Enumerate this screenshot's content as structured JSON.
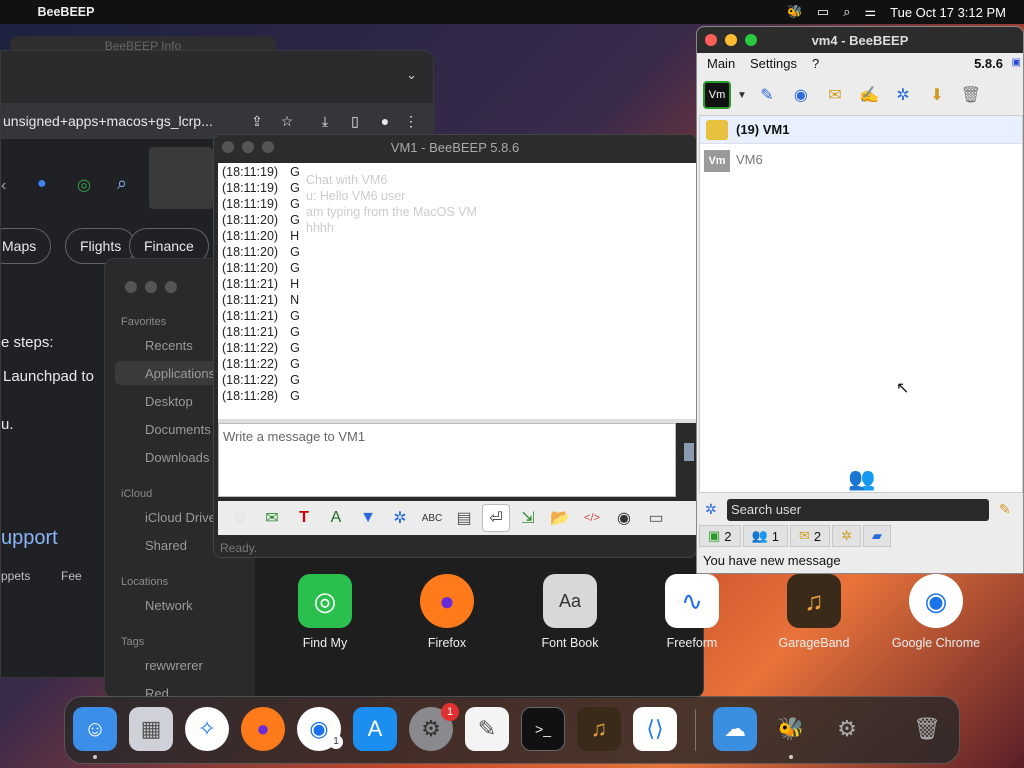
{
  "menubar": {
    "app_name": "BeeBEEP",
    "datetime": "Tue Oct 17  3:12 PM"
  },
  "bg_window": {
    "title": "BeeBEEP Info"
  },
  "chrome": {
    "address": "unsigned+apps+macos+gs_lcrp...",
    "chips": [
      "Maps",
      "Flights",
      "Finance"
    ],
    "steps_text": "e steps:",
    "launchpad_text": "Launchpad to",
    "u_text": "u.",
    "support_link": "upport",
    "footer_snippets": "ppets",
    "footer_feedback": "Fee"
  },
  "finder": {
    "favorites_header": "Favorites",
    "favorites": [
      "Recents",
      "Applications",
      "Desktop",
      "Documents",
      "Downloads"
    ],
    "icloud_header": "iCloud",
    "icloud": [
      "iCloud Drive",
      "Shared"
    ],
    "locations_header": "Locations",
    "locations": [
      "Network"
    ],
    "tags_header": "Tags",
    "tags": [
      "rewwrerer",
      "Red"
    ]
  },
  "vm1": {
    "title": "VM1 - BeeBEEP 5.8.6",
    "log": [
      {
        "t": "(18:11:19)",
        "m": "G"
      },
      {
        "t": "(18:11:19)",
        "m": "G"
      },
      {
        "t": "(18:11:19)",
        "m": "G"
      },
      {
        "t": "(18:11:20)",
        "m": "G"
      },
      {
        "t": "(18:11:20)",
        "m": "H"
      },
      {
        "t": "(18:11:20)",
        "m": "G"
      },
      {
        "t": "(18:11:20)",
        "m": "G"
      },
      {
        "t": "(18:11:21)",
        "m": "H"
      },
      {
        "t": "(18:11:21)",
        "m": "N"
      },
      {
        "t": "(18:11:21)",
        "m": "G"
      },
      {
        "t": "(18:11:21)",
        "m": "G"
      },
      {
        "t": "(18:11:22)",
        "m": "G"
      },
      {
        "t": "(18:11:22)",
        "m": "G"
      },
      {
        "t": "(18:11:22)",
        "m": "G"
      },
      {
        "t": "(18:11:28)",
        "m": "G"
      }
    ],
    "ghost_lines": [
      "Chat with VM6",
      "u: Hello VM6 user",
      "am typing from the MacOS VM",
      "hhhh"
    ],
    "placeholder": "Write a message to VM1",
    "status": "Ready."
  },
  "vm4": {
    "title": "vm4 - BeeBEEP",
    "menu": [
      "Main",
      "Settings",
      "?"
    ],
    "version": "5.8.6",
    "users": [
      {
        "label": "(19) VM1",
        "unread": true
      },
      {
        "label": "VM6",
        "unread": false
      }
    ],
    "search_placeholder": "Search user",
    "counts": {
      "online": "2",
      "groups": "1",
      "chats": "2"
    },
    "status": "You have new message"
  },
  "apps": [
    "Find My",
    "Firefox",
    "Font Book",
    "Freeform",
    "GarageBand",
    "Google Chrome"
  ],
  "dock": {
    "settings_badge": "1",
    "chrome_badge": "1"
  },
  "colors": {
    "accent": "#0a84ff",
    "unread_row": "#e8f0fe",
    "traffic_red": "#ff5f57",
    "traffic_yellow": "#febc2e",
    "traffic_green": "#28c840"
  }
}
